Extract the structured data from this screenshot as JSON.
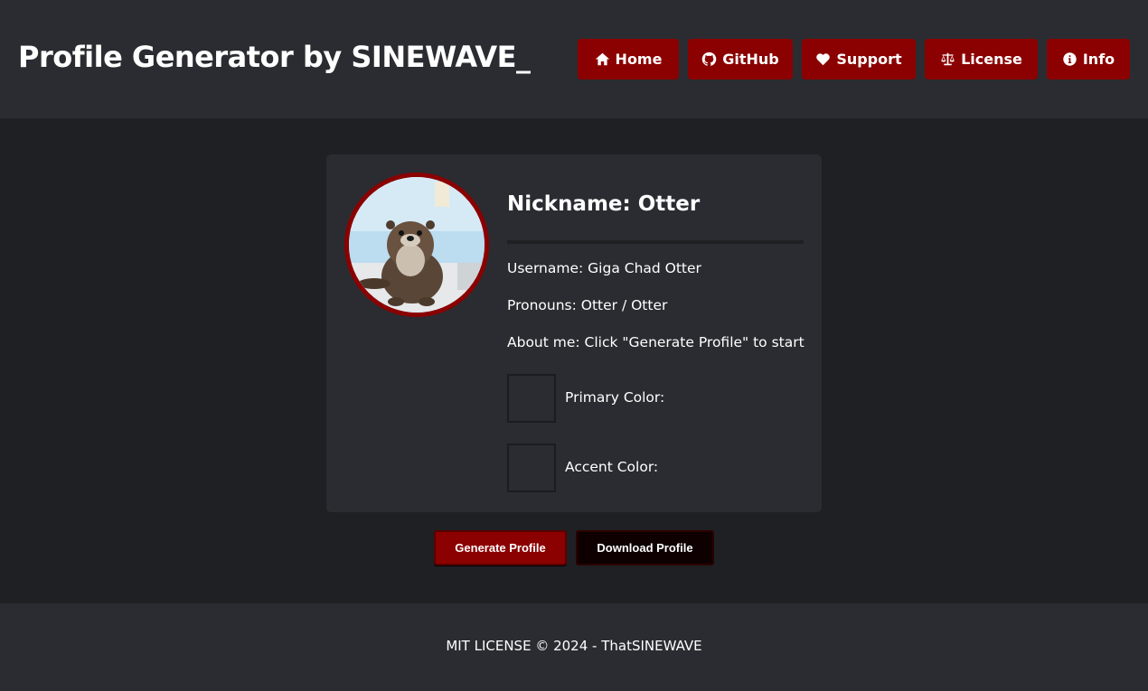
{
  "header": {
    "title": "Profile Generator by SINEWAVE_",
    "nav": [
      {
        "label": "Home",
        "icon": "home-icon"
      },
      {
        "label": "GitHub",
        "icon": "github-icon"
      },
      {
        "label": "Support",
        "icon": "heart-icon"
      },
      {
        "label": "License",
        "icon": "scale-icon"
      },
      {
        "label": "Info",
        "icon": "info-icon"
      }
    ]
  },
  "profile": {
    "nickname": "Nickname: Otter",
    "username": "Username: Giga Chad Otter",
    "pronouns": "Pronouns: Otter / Otter",
    "about": "About me: Click \"Generate Profile\" to start",
    "primary_color_label": "Primary Color:",
    "accent_color_label": "Accent Color:"
  },
  "actions": {
    "generate_label": "Generate Profile",
    "download_label": "Download Profile"
  },
  "footer": {
    "text": "MIT LICENSE © 2024 - ThatSINEWAVE"
  },
  "colors": {
    "accent": "#8b0000",
    "header_bg": "#2b2c31",
    "page_bg": "#1f2024",
    "download_bg": "#0e0000"
  }
}
